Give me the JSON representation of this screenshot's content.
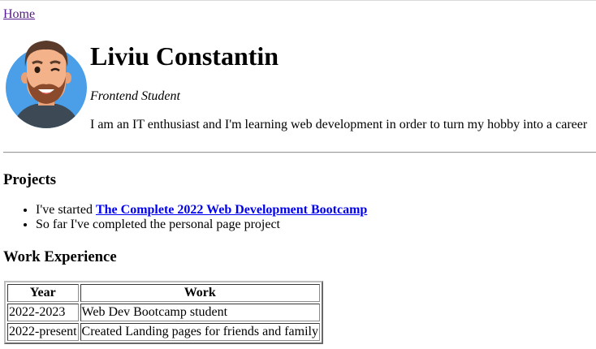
{
  "nav": {
    "home_label": "Home"
  },
  "profile": {
    "name": "Liviu Constantin",
    "subtitle": "Frontend Student",
    "bio": "I am an IT enthusiast and I'm learning web development in order to turn my hobby into a career",
    "avatar_icon": "cartoon-avatar-icon"
  },
  "projects": {
    "heading": "Projects",
    "item1_prefix": "I've started ",
    "item1_link": "The Complete 2022 Web Development Bootcamp",
    "item2": "So far I've completed the personal page project"
  },
  "work": {
    "heading": "Work Experience",
    "columns": [
      "Year",
      "Work"
    ],
    "rows": [
      [
        "2022-2023",
        "Web Dev Bootcamp student"
      ],
      [
        "2022-present",
        "Created Landing pages for friends and family"
      ]
    ]
  },
  "colors": {
    "visited_link": "#551a8b",
    "link": "#0000ee",
    "avatar_bg": "#4a9fe8"
  }
}
